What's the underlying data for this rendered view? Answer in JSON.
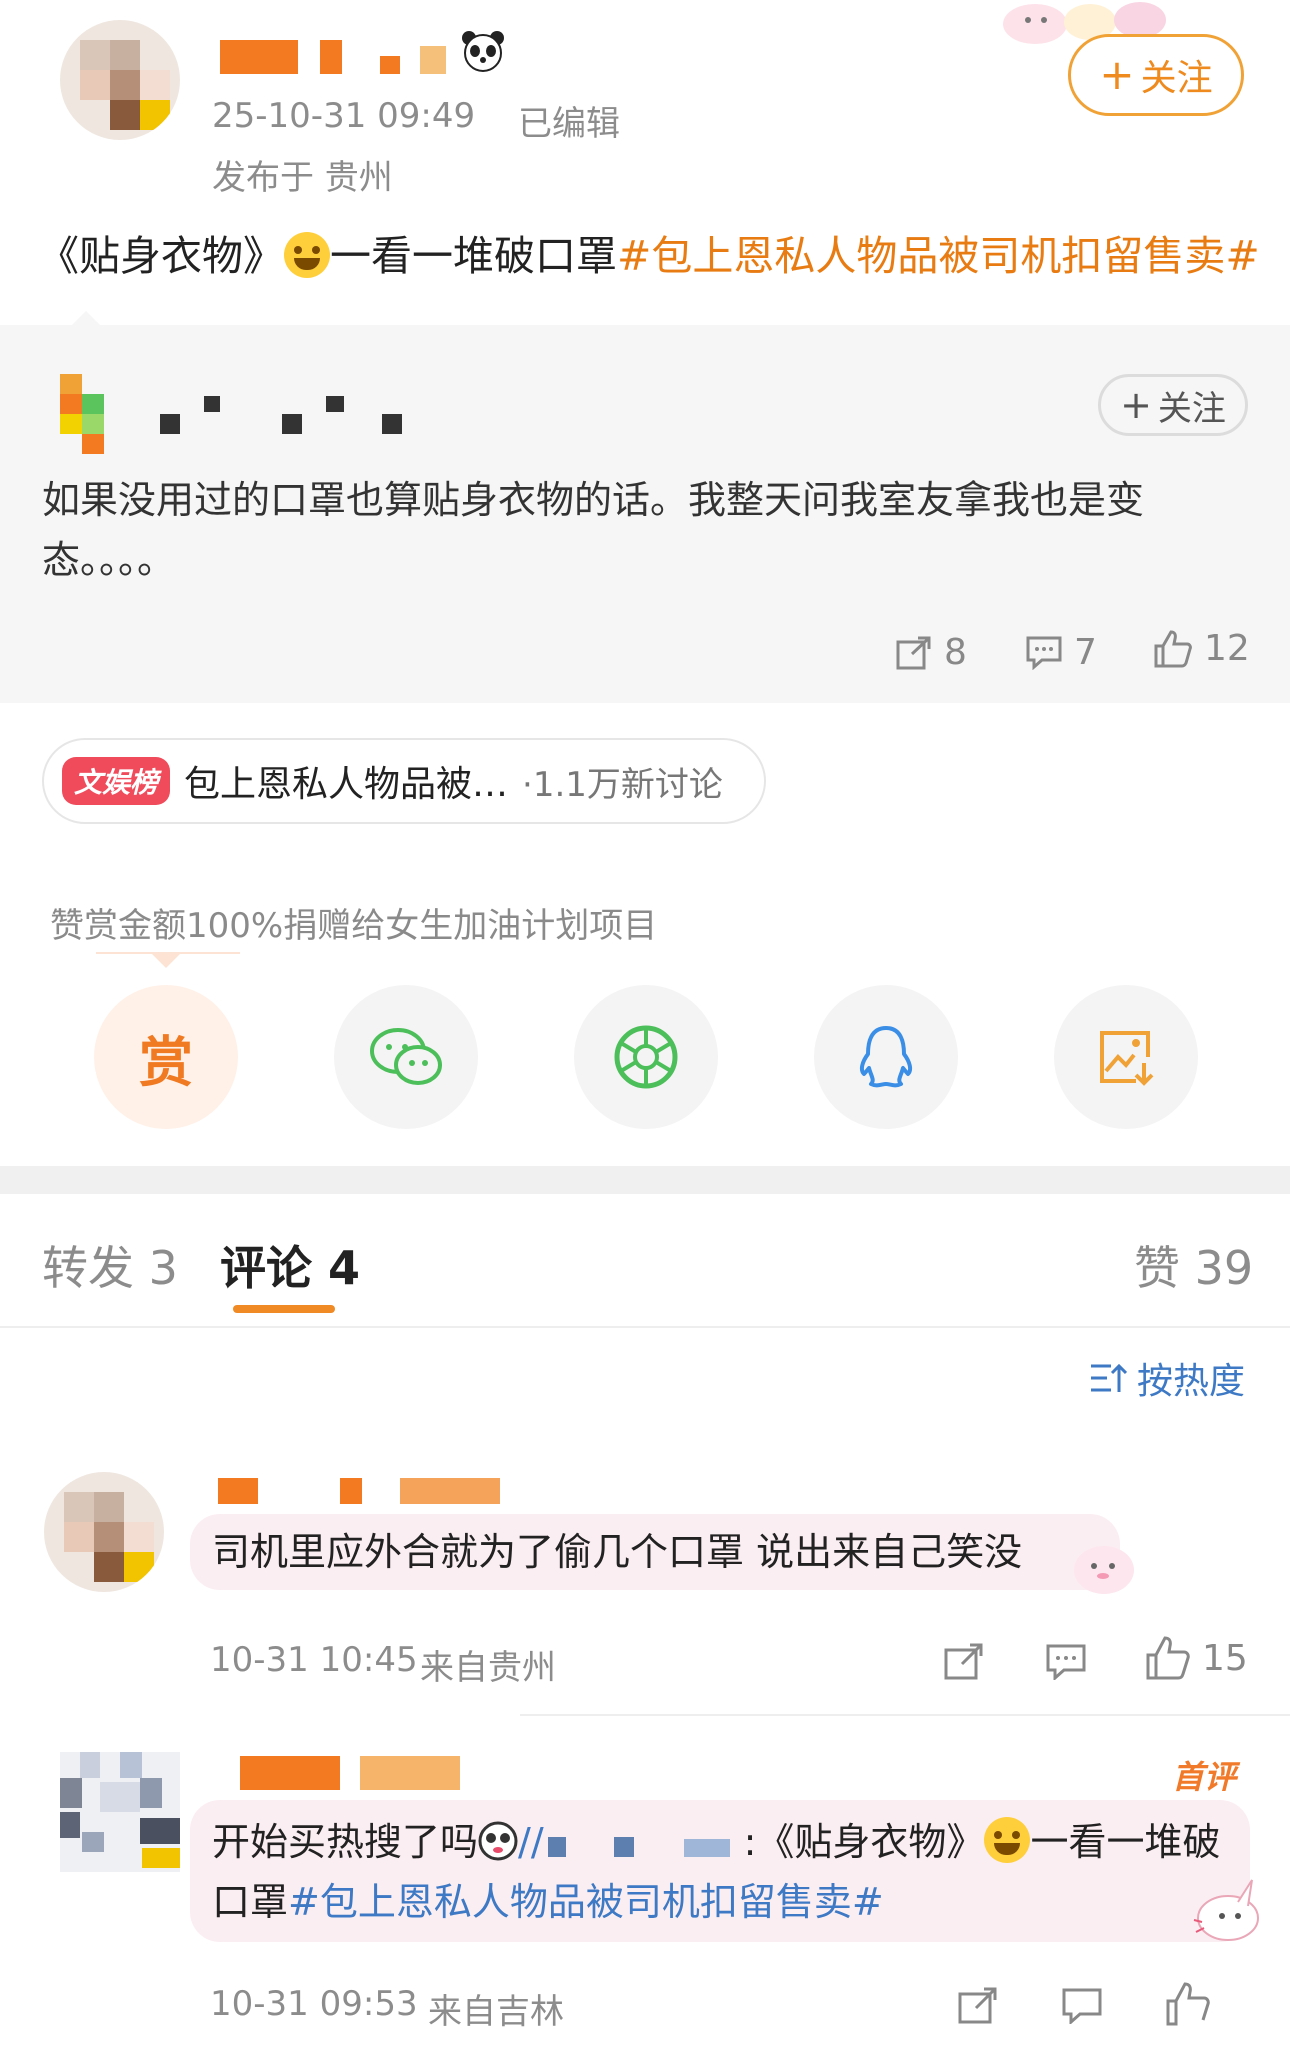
{
  "post": {
    "timestamp": "25-10-31 09:49",
    "edited_label": "已编辑",
    "location": "发布于 贵州",
    "follow_label": "关注",
    "text_main": "《贴身衣物》",
    "text_rest": "一看一堆破口罩",
    "hashtag": "#包上恩私人物品被司机扣留售卖#"
  },
  "quoted": {
    "follow_label": "关注",
    "text_line1": "如果没用过的口罩也算贴身衣物的话。我整天问我室友拿我也是变",
    "text_line2": "态。。。。",
    "repost_count": "8",
    "comment_count": "7",
    "like_count": "12"
  },
  "topic": {
    "badge": "文娱榜",
    "title": "包上恩私人物品被…",
    "count": "·1.1万新讨论"
  },
  "reward_note": "赞赏金额100%捐赠给女生加油计划项目",
  "share": [
    {
      "name": "reward",
      "label": "赏"
    },
    {
      "name": "wechat"
    },
    {
      "name": "moments"
    },
    {
      "name": "qq"
    },
    {
      "name": "save-image"
    }
  ],
  "tabs": {
    "repost": "转发 3",
    "comment": "评论 4",
    "like": "赞 39"
  },
  "sort_label": "按热度",
  "comments": [
    {
      "text": "司机里应外合就为了偷几个口罩 说出来自己笑没",
      "time": "10-31 10:45",
      "source": "来自贵州",
      "likes": "15"
    },
    {
      "badge": "首评",
      "text_line1_a": "开始买热搜了吗",
      "text_line1_b": "//",
      "text_line1_c": ":《贴身衣物》",
      "text_line1_d": "一看一堆破",
      "text_line2_a": "口罩",
      "hashtag": "#包上恩私人物品被司机扣留售卖#",
      "time": "10-31 09:53",
      "source": "来自吉林"
    }
  ],
  "colors": {
    "accent_orange": "#ee8a1e",
    "link_blue": "#3d79c4",
    "topic_red": "#f04b5b"
  }
}
